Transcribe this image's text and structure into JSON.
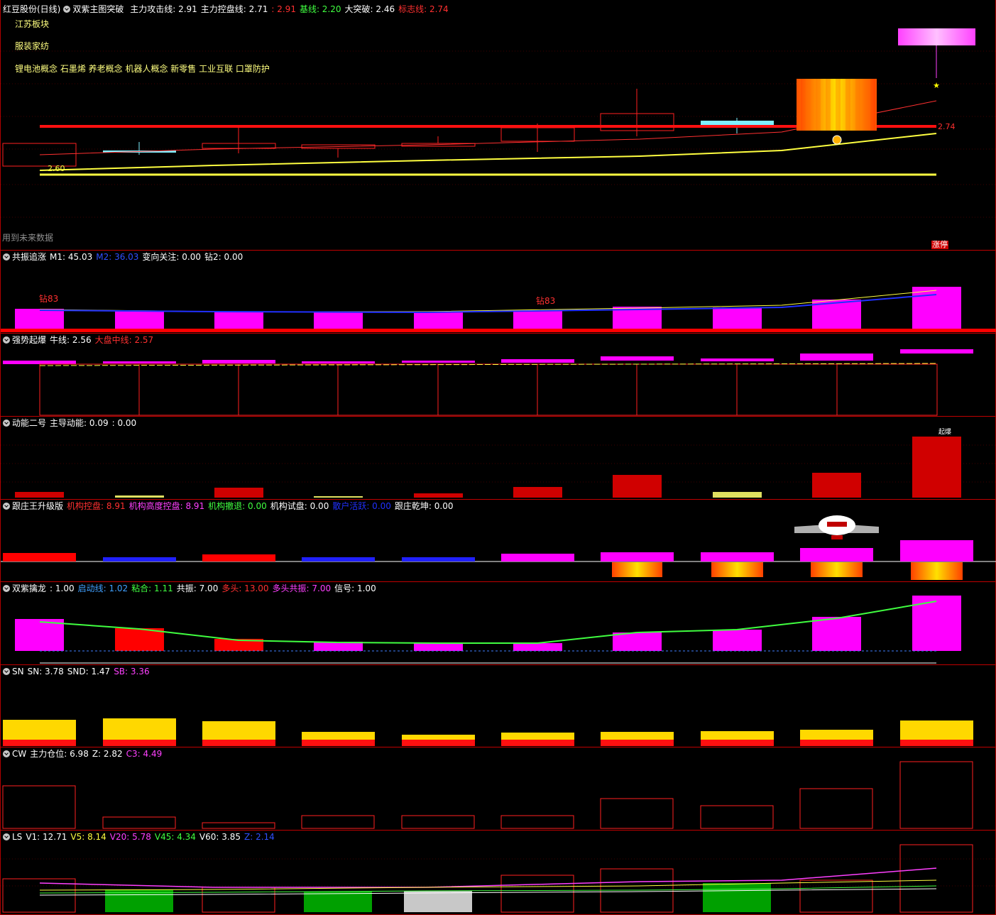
{
  "main": {
    "stock": "红豆股份(日线)",
    "indicator": "双紫主图突破",
    "fields": [
      {
        "label": "主力攻击线:",
        "value": "2.91",
        "color": "#ffffff"
      },
      {
        "label": "主力控盘线:",
        "value": "2.71",
        "color": "#ffffff"
      },
      {
        "label": ":",
        "value": "2.91",
        "color": "#ff3030"
      },
      {
        "label": "基线:",
        "value": "2.20",
        "color": "#40ff40"
      },
      {
        "label": "大突破:",
        "value": "2.46",
        "color": "#ffffff"
      },
      {
        "label": "标志线:",
        "value": "2.74",
        "color": "#ff3030"
      }
    ],
    "sectors": [
      "江苏板块",
      "服装家纺",
      "锂电池概念 石墨烯 养老概念 机器人概念 新零售 工业互联 口罩防护"
    ],
    "price_label_left": "2.60",
    "price_label_right": "2.74",
    "future_warning": "用到未来数据",
    "limit_up_tag": "涨停"
  },
  "panels": [
    {
      "name": "共振追涨",
      "fields": [
        {
          "label": "M1:",
          "value": "45.03",
          "color": "#ffffff"
        },
        {
          "label": "M2:",
          "value": "36.03",
          "color": "#3050ff"
        },
        {
          "label": "变向关注:",
          "value": "0.00",
          "color": "#ffffff"
        },
        {
          "label": "钻2:",
          "value": "0.00",
          "color": "#ffffff"
        }
      ],
      "markers": [
        "钻83",
        "钻83"
      ]
    },
    {
      "name": "强势起爆",
      "fields": [
        {
          "label": "牛线:",
          "value": "2.56",
          "color": "#ffffff"
        },
        {
          "label": "大盘中线:",
          "value": "2.57",
          "color": "#ff3030"
        }
      ]
    },
    {
      "name": "动能二号",
      "fields": [
        {
          "label": "主导动能:",
          "value": "0.09",
          "color": "#ffffff"
        },
        {
          "label": ":",
          "value": "0.00",
          "color": "#ffffff"
        }
      ],
      "top_label": "起爆"
    },
    {
      "name": "跟庄王升级版",
      "fields": [
        {
          "label": "机构控盘:",
          "value": "8.91",
          "color": "#ff3030"
        },
        {
          "label": "机构高度控盘:",
          "value": "8.91",
          "color": "#ff40ff"
        },
        {
          "label": "机构撤退:",
          "value": "0.00",
          "color": "#40ff40"
        },
        {
          "label": "机构试盘:",
          "value": "0.00",
          "color": "#ffffff"
        },
        {
          "label": "散户活跃:",
          "value": "0.00",
          "color": "#2030ff"
        },
        {
          "label": "跟庄乾坤:",
          "value": "0.00",
          "color": "#ffffff"
        }
      ]
    },
    {
      "name": "双紫擒龙",
      "fields": [
        {
          "label": ":",
          "value": "1.00",
          "color": "#ffffff"
        },
        {
          "label": "启动线:",
          "value": "1.02",
          "color": "#40a0ff"
        },
        {
          "label": "粘合:",
          "value": "1.11",
          "color": "#40ff40"
        },
        {
          "label": "共振:",
          "value": "7.00",
          "color": "#ffffff"
        },
        {
          "label": "多头:",
          "value": "13.00",
          "color": "#ff3030"
        },
        {
          "label": "多头共振:",
          "value": "7.00",
          "color": "#ff40ff"
        },
        {
          "label": "信号:",
          "value": "1.00",
          "color": "#ffffff"
        }
      ]
    },
    {
      "name": "SN",
      "fields": [
        {
          "label": "SN:",
          "value": "3.78",
          "color": "#ffffff"
        },
        {
          "label": "SND:",
          "value": "1.47",
          "color": "#ffffff"
        },
        {
          "label": "SB:",
          "value": "3.36",
          "color": "#ff40ff"
        }
      ]
    },
    {
      "name": "CW",
      "fields": [
        {
          "label": "主力仓位:",
          "value": "6.98",
          "color": "#ffffff"
        },
        {
          "label": "Z:",
          "value": "2.82",
          "color": "#ffffff"
        },
        {
          "label": "C3:",
          "value": "4.49",
          "color": "#ff40ff"
        }
      ]
    },
    {
      "name": "LS",
      "fields": [
        {
          "label": "V1:",
          "value": "12.71",
          "color": "#ffffff"
        },
        {
          "label": "V5:",
          "value": "8.14",
          "color": "#ffff40"
        },
        {
          "label": "V20:",
          "value": "5.78",
          "color": "#ff40ff"
        },
        {
          "label": "V45:",
          "value": "4.34",
          "color": "#40ff40"
        },
        {
          "label": "V60:",
          "value": "3.85",
          "color": "#ffffff"
        },
        {
          "label": "Z:",
          "value": "2.14",
          "color": "#3050ff"
        }
      ]
    }
  ]
}
